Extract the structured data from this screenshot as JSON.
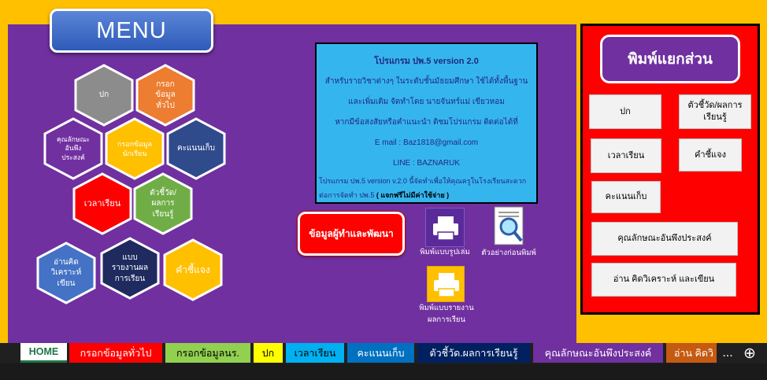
{
  "menu": {
    "title": "MENU"
  },
  "hexagons": [
    {
      "id": "cover",
      "label": "ปก",
      "color": "#8c8c8c"
    },
    {
      "id": "general",
      "label": "กรอก\nข้อมูล\nทั่วไป",
      "color": "#ed7d31"
    },
    {
      "id": "character",
      "label": "คุณลักษณะ\nอันพึง\nประสงค์",
      "color": "#7030a0"
    },
    {
      "id": "student",
      "label": "กรอกข้อมูล\nนักเรียน",
      "color": "#ffc000"
    },
    {
      "id": "score",
      "label": "คะแนนเก็บ",
      "color": "#2f4b8c"
    },
    {
      "id": "time",
      "label": "เวลาเรียน",
      "color": "#ff0000"
    },
    {
      "id": "indicator",
      "label": "ตัวชี้วัด/\nผลการ\nเรียนรู้",
      "color": "#70ad47"
    },
    {
      "id": "reading",
      "label": "อ่านคิด\nวิเคราะห์\nเขียน",
      "color": "#4472c4"
    },
    {
      "id": "report",
      "label": "แบบ\nรายงานผล\nการเรียน",
      "color": "#1f2b5e"
    },
    {
      "id": "explain",
      "label": "คำชี้แจง",
      "color": "#ffc000"
    }
  ],
  "info": {
    "title": "โปรแกรม ปพ.5 version 2.0",
    "line1": "สำหรับรายวิชาต่างๆ ในระดับชั้นมัธยมศึกษา ใช้ได้ทั้งพื้นฐาน",
    "line2": "และเพิ่มเติม   จัดทำโดย   นายจันทร์แม่ เขียวหอม",
    "line3": "หากมีข้อสงสัยหรือคำแนะนำ ติชมโปรแกรม ติดต่อได้ที่",
    "email": "E mail : Baz1818@gmail.com",
    "line": "LINE : BAZNARUK",
    "line4": "โปรแกรม ปพ.5 version v.2.0  นี้จัดทำเพื่อให้คุณครูในโรงเรียนสะดวก",
    "line5a": "ต่อการจัดทำ ปพ.5  ",
    "line5b": "( แจกฟรีไม่มีค่าใช้จ่าย )"
  },
  "dev_button": "ข้อมูลผู้ทำและพัฒนา",
  "print_items": {
    "original": "พิมพ์แบบรูปเล่ม",
    "preview": "ตัวอย่างก่อนพิมพ์",
    "report": "พิมพ์แบบรายงาน\nผลการเรียน"
  },
  "print_panel": {
    "title": "พิมพ์แยกส่วน",
    "buttons": {
      "cover": "ปก",
      "indicator": "ตัวชี้วัด/ผลการ\nเรียนรู้",
      "time": "เวลาเรียน",
      "explain": "คำชี้แจง",
      "score": "คะแนนเก็บ",
      "character": "คุณลักษณะอันพึงประสงค์",
      "reading": "อ่าน คิดวิเคราะห์ และเขียน"
    }
  },
  "tabs": [
    {
      "label": "HOME",
      "bg": "#ffffff",
      "color": "#217346"
    },
    {
      "label": "กรอกข้อมูลทั่วไป",
      "bg": "#ff0000",
      "color": "#ffffff"
    },
    {
      "label": "กรอกข้อมูลนร.",
      "bg": "#92d050",
      "color": "#000000"
    },
    {
      "label": "ปก",
      "bg": "#ffff00",
      "color": "#000000"
    },
    {
      "label": "เวลาเรียน",
      "bg": "#00b0f0",
      "color": "#000000"
    },
    {
      "label": "คะแนนเก็บ",
      "bg": "#0070c0",
      "color": "#ffffff"
    },
    {
      "label": "ตัวชี้วัด.ผลการเรียนรู้",
      "bg": "#002060",
      "color": "#ffffff"
    },
    {
      "label": "คุณลักษณะอันพึงประสงค์",
      "bg": "#7030a0",
      "color": "#ffffff"
    },
    {
      "label": "อ่าน คิดวิ",
      "bg": "#c55a11",
      "color": "#ffffff"
    }
  ],
  "tab_controls": {
    "more": "...",
    "add": "⊕"
  }
}
